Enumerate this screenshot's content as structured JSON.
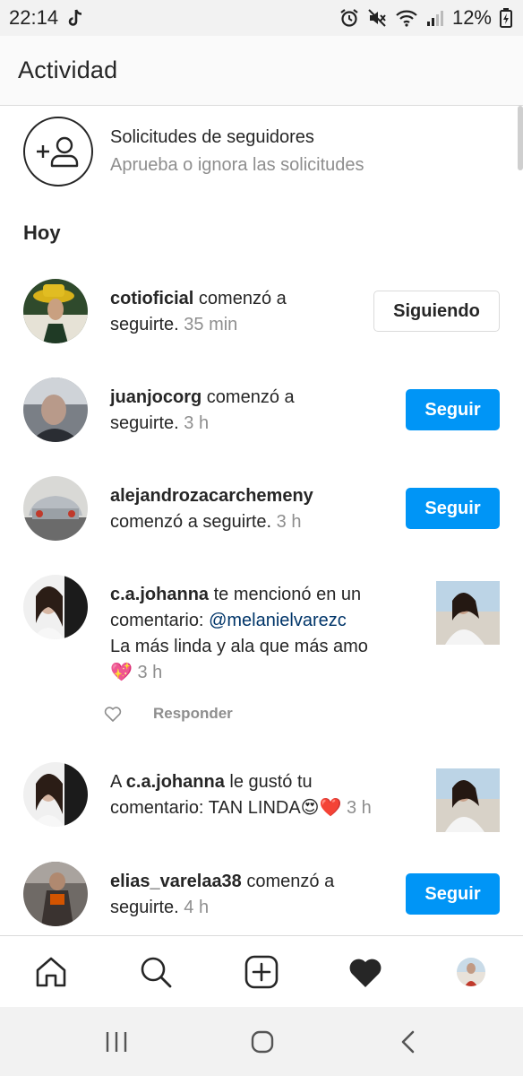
{
  "status_bar": {
    "time": "22:14",
    "battery": "12%",
    "icons": [
      "tiktok-icon",
      "alarm-icon",
      "mute-icon",
      "wifi-icon",
      "signal-icon",
      "battery-icon"
    ]
  },
  "header": {
    "title": "Actividad"
  },
  "follow_requests": {
    "title": "Solicitudes de seguidores",
    "subtitle": "Aprueba o ignora las solicitudes"
  },
  "section": {
    "title": "Hoy"
  },
  "activity": [
    {
      "username": "cotioficial",
      "action": " comenzó a",
      "line2": "seguirte.",
      "time": " 35 min",
      "button": "Siguiendo"
    },
    {
      "username": "juanjocorg",
      "action": " comenzó a",
      "line2": "seguirte.",
      "time": " 3 h",
      "button": "Seguir"
    },
    {
      "username": "alejandrozacarchemeny",
      "action": "",
      "line2": "comenzó a seguirte.",
      "time": " 3 h",
      "button": "Seguir"
    },
    {
      "username": "c.a.johanna",
      "action": " te mencionó en un",
      "line2": "comentario: ",
      "mention": "@melanielvarezc",
      "line3": "La más linda y ala que más amo",
      "emoji": "💖",
      "time": " 3 h",
      "reply": "Responder"
    },
    {
      "prefix": "A ",
      "username": "c.a.johanna",
      "action": " le gustó tu",
      "line2": "comentario: TAN LINDA😍❤️",
      "time": " 3 h"
    },
    {
      "username": "elias_varelaa38",
      "action": " comenzó a",
      "line2": "seguirte.",
      "time": " 4 h",
      "button": "Seguir"
    }
  ],
  "bottom_nav": [
    "home-icon",
    "search-icon",
    "new-post-icon",
    "activity-heart-icon",
    "profile-avatar"
  ],
  "colors": {
    "accent": "#0095f6",
    "text": "#262626",
    "secondary": "#8e8e8e",
    "mention": "#003569"
  }
}
